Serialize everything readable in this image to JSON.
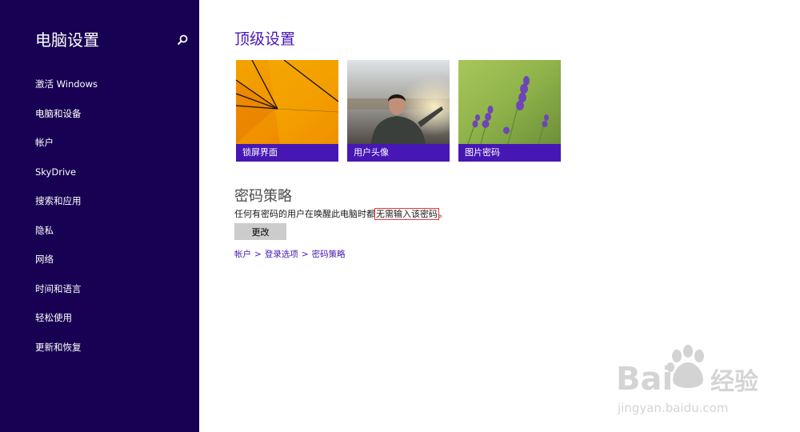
{
  "sidebar": {
    "title": "电脑设置",
    "search_icon": "search-icon",
    "items": [
      {
        "label": "激活 Windows"
      },
      {
        "label": "电脑和设备"
      },
      {
        "label": "帐户"
      },
      {
        "label": "SkyDrive"
      },
      {
        "label": "搜索和应用"
      },
      {
        "label": "隐私"
      },
      {
        "label": "网络"
      },
      {
        "label": "时间和语言"
      },
      {
        "label": "轻松使用"
      },
      {
        "label": "更新和恢复"
      }
    ]
  },
  "main": {
    "title": "顶级设置",
    "tiles": [
      {
        "label": "锁屏界面"
      },
      {
        "label": "用户头像"
      },
      {
        "label": "图片密码"
      }
    ],
    "section": {
      "title": "密码策略",
      "desc_before": "任何有密码的用户在唤醒此电脑时都",
      "desc_highlight": "无需输入该密码",
      "desc_after": "。",
      "button_label": "更改"
    },
    "breadcrumb": [
      {
        "label": "帐户"
      },
      {
        "label": "登录选项"
      },
      {
        "label": "密码策略"
      }
    ],
    "breadcrumb_sep": ">"
  },
  "watermark": {
    "brand": "Baidu",
    "brand_cn": "经验",
    "url": "jingyan.baidu.com"
  },
  "colors": {
    "sidebar_bg": "#180052",
    "accent": "#4617b4",
    "highlight_box": "#e53a3a"
  }
}
